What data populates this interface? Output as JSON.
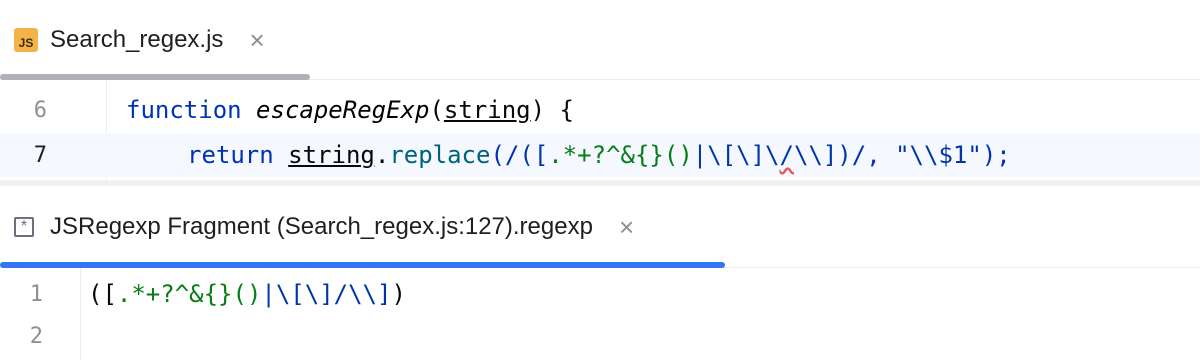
{
  "editor_tab": {
    "icon_text": "JS",
    "title": "Search_regex.js",
    "close_glyph": "×"
  },
  "editor": {
    "lines": [
      {
        "number": "6",
        "tokens": {
          "kw1": "function",
          "fn": "escapeRegExp",
          "p1": "(",
          "param": "string",
          "p2": ") {"
        }
      },
      {
        "number": "7",
        "tokens": {
          "kw": "return",
          "obj": "string",
          "dot": ".",
          "method": "replace",
          "open": "(/",
          "rx_a": "([",
          "rx_b": ".*+?^&{}()",
          "rx_c": "|\\[\\]\\",
          "rx_d": "/",
          "rx_e": "\\\\]",
          "rx_f": ")",
          "close": "/, ",
          "str": "\"\\\\$1\"",
          "end": ");"
        }
      }
    ]
  },
  "fragment_tab": {
    "icon_glyph": "*",
    "title": "JSRegexp Fragment (Search_regex.js:127).regexp",
    "close_glyph": "×"
  },
  "fragment_editor": {
    "lines": [
      {
        "number": "1",
        "tokens": {
          "a": "([",
          "b": ".*+?^&{}()",
          "c": "|\\[\\]/\\\\]",
          "d": ")"
        }
      },
      {
        "number": "2"
      }
    ]
  },
  "colors": {
    "keyword": "#0033b3",
    "method": "#00627a",
    "regex": "#067d17",
    "active_tab_underline": "#3574f0",
    "js_badge": "#f2b449"
  }
}
